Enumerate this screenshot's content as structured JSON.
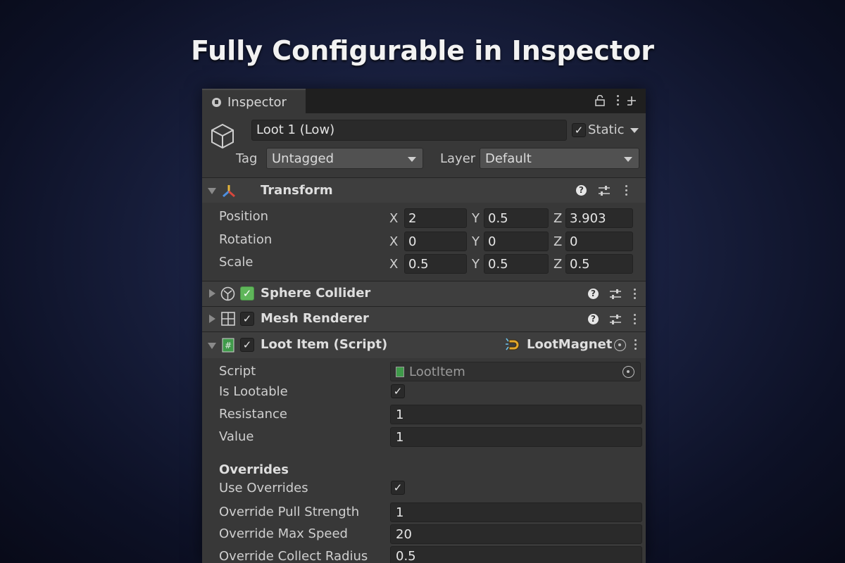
{
  "hero_title": "Fully Configurable in Inspector",
  "window": {
    "tab_label": "Inspector",
    "icons": [
      "lock-icon",
      "kebab-icon",
      "add-tab-icon"
    ]
  },
  "object": {
    "name": "Loot 1 (Low)",
    "static_label": "Static",
    "static_checked": true,
    "tag_label": "Tag",
    "tag_value": "Untagged",
    "layer_label": "Layer",
    "layer_value": "Default"
  },
  "transform": {
    "title": "Transform",
    "rows": [
      {
        "label": "Position",
        "x": "2",
        "y": "0.5",
        "z": "3.903"
      },
      {
        "label": "Rotation",
        "x": "0",
        "y": "0",
        "z": "0"
      },
      {
        "label": "Scale",
        "x": "0.5",
        "y": "0.5",
        "z": "0.5"
      }
    ],
    "axis_x": "X",
    "axis_y": "Y",
    "axis_z": "Z"
  },
  "sphere_collider": {
    "title": "Sphere Collider",
    "enabled": true
  },
  "mesh_renderer": {
    "title": "Mesh Renderer",
    "enabled": true
  },
  "loot_item": {
    "title": "Loot Item (Script)",
    "enabled": true,
    "badge": "LootMagnet",
    "fields": {
      "script_label": "Script",
      "script_value": "LootItem",
      "is_lootable_label": "Is Lootable",
      "is_lootable": true,
      "resistance_label": "Resistance",
      "resistance_value": "1",
      "value_label": "Value",
      "value_value": "1"
    },
    "overrides": {
      "heading": "Overrides",
      "use_overrides_label": "Use Overrides",
      "use_overrides": true,
      "pull_strength_label": "Override Pull Strength",
      "pull_strength_value": "1",
      "max_speed_label": "Override Max Speed",
      "max_speed_value": "20",
      "collect_radius_label": "Override Collect Radius",
      "collect_radius_value": "0.5"
    }
  },
  "check_glyph": "✓",
  "help_glyph": "?",
  "colors": {
    "collider_check": "#5fb65a",
    "panel": "#383838",
    "field": "#2a2a2a"
  }
}
